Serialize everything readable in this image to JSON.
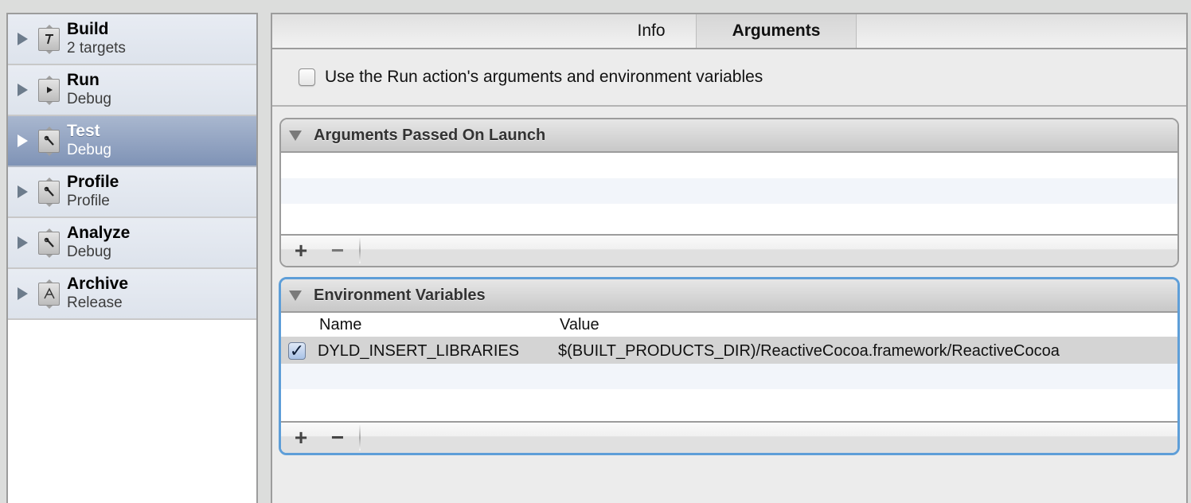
{
  "sidebar": {
    "schemes": [
      {
        "name": "Build",
        "subtitle": "2 targets",
        "icon": "hammer-icon",
        "glyph": "𝑇",
        "selected": false
      },
      {
        "name": "Run",
        "subtitle": "Debug",
        "icon": "play-icon",
        "glyph": "▶",
        "selected": false
      },
      {
        "name": "Test",
        "subtitle": "Debug",
        "icon": "wrench-icon",
        "glyph": "🔧",
        "selected": true
      },
      {
        "name": "Profile",
        "subtitle": "Profile",
        "icon": "wrench-icon",
        "glyph": "🔧",
        "selected": false
      },
      {
        "name": "Analyze",
        "subtitle": "Debug",
        "icon": "wrench-icon",
        "glyph": "🔧",
        "selected": false
      },
      {
        "name": "Archive",
        "subtitle": "Release",
        "icon": "archive-icon",
        "glyph": "A",
        "selected": false
      }
    ]
  },
  "tabs": [
    {
      "label": "Info",
      "active": false
    },
    {
      "label": "Arguments",
      "active": true
    }
  ],
  "options": {
    "use_run_action_label": "Use the Run action's arguments and environment variables",
    "use_run_action_checked": false
  },
  "arguments_group": {
    "title": "Arguments Passed On Launch",
    "rows": [],
    "add_label": "+",
    "remove_label": "−"
  },
  "environment_group": {
    "title": "Environment Variables",
    "columns": {
      "name": "Name",
      "value": "Value"
    },
    "rows": [
      {
        "enabled": true,
        "name": "DYLD_INSERT_LIBRARIES",
        "value": "$(BUILT_PRODUCTS_DIR)/ReactiveCocoa.framework/ReactiveCocoa"
      }
    ],
    "add_label": "+",
    "remove_label": "−",
    "focus_color": "#5e9ed8"
  },
  "colors": {
    "selection_top": "#a9b7cf",
    "selection_bottom": "#7f93b6"
  }
}
